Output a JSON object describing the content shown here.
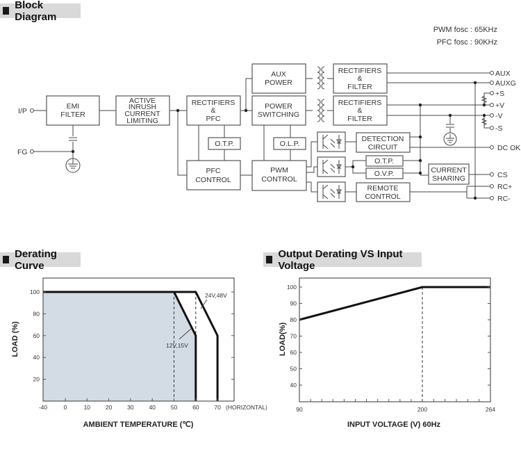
{
  "sections": {
    "block_diagram": {
      "title": "Block Diagram"
    },
    "derating_curve": {
      "title": "Derating Curve"
    },
    "output_derating": {
      "title": "Output Derating VS Input Voltage"
    }
  },
  "block_diagram": {
    "notes": {
      "pwm": "PWM fosc : 65KHz",
      "pfc": "PFC fosc : 90KHz"
    },
    "blocks": {
      "emi_filter": [
        "EMI",
        "FILTER"
      ],
      "inrush": [
        "ACTIVE",
        "INRUSH",
        "CURRENT",
        "LIMITING"
      ],
      "rect_pfc": [
        "RECTIFIERS",
        "&",
        "PFC"
      ],
      "otp1": [
        "O.T.P."
      ],
      "pfc_control": [
        "PFC",
        "CONTROL"
      ],
      "aux_power": [
        "AUX",
        "POWER"
      ],
      "power_switching": [
        "POWER",
        "SWITCHING"
      ],
      "olp": [
        "O.L.P."
      ],
      "pwm_control": [
        "PWM",
        "CONTROL"
      ],
      "rect_filter_aux": [
        "RECTIFIERS",
        "&",
        "FILTER"
      ],
      "rect_filter_main": [
        "RECTIFIERS",
        "&",
        "FILTER"
      ],
      "detection": [
        "DETECTION",
        "CIRCUIT"
      ],
      "otp2": [
        "O.T.P."
      ],
      "ovp": [
        "O.V.P."
      ],
      "remote": [
        "REMOTE",
        "CONTROL"
      ],
      "current_sharing": [
        "CURRENT",
        "SHARING"
      ]
    },
    "input_terminals": [
      "I/P",
      "FG"
    ],
    "output_terminals": [
      "AUX",
      "AUXG",
      "+S",
      "+V",
      "-V",
      "-S",
      "DC OK",
      "CS",
      "RC+",
      "RC-"
    ]
  },
  "chart_data": [
    {
      "type": "line",
      "title": "Derating Curve",
      "xlabel": "AMBIENT TEMPERATURE (℃)",
      "ylabel": "LOAD (%)",
      "x_ticks": [
        "-40",
        "0",
        "10",
        "20",
        "30",
        "40",
        "50",
        "60",
        "70"
      ],
      "x_tick_values": [
        -40,
        0,
        10,
        20,
        30,
        40,
        50,
        60,
        70
      ],
      "x_tick_suffix": "(HORIZONTAL)",
      "y_ticks": [
        "20",
        "40",
        "60",
        "80",
        "100"
      ],
      "y_tick_values": [
        20,
        40,
        60,
        80,
        100
      ],
      "xlim": [
        -40,
        80
      ],
      "ylim": [
        0,
        112
      ],
      "grid": false,
      "shaded_region": "area under 12V,15V curve",
      "series": [
        {
          "name": "12V,15V",
          "x": [
            -40,
            50,
            60,
            60
          ],
          "y": [
            100,
            100,
            60,
            0
          ]
        },
        {
          "name": "24V,48V",
          "x": [
            -40,
            60,
            70,
            70
          ],
          "y": [
            100,
            100,
            60,
            0
          ]
        }
      ],
      "reference_lines_x": [
        50,
        60
      ],
      "annotations": [
        "24V,48V",
        "12V,15V"
      ]
    },
    {
      "type": "line",
      "title": "Output Derating VS Input Voltage",
      "xlabel": "INPUT VOLTAGE (V) 60Hz",
      "ylabel": "LOAD(%)",
      "x_ticks": [
        "90",
        "200",
        "264"
      ],
      "x_tick_values": [
        90,
        200,
        264
      ],
      "y_ticks": [
        "40",
        "50",
        "60",
        "70",
        "80",
        "90",
        "100"
      ],
      "y_tick_values": [
        40,
        50,
        60,
        70,
        80,
        90,
        100
      ],
      "xlim": [
        90,
        264
      ],
      "ylim": [
        30,
        105
      ],
      "grid": false,
      "series": [
        {
          "name": "Load",
          "x": [
            90,
            200,
            264
          ],
          "y": [
            80,
            100,
            100
          ]
        }
      ],
      "reference_lines_x": [
        200
      ]
    }
  ]
}
